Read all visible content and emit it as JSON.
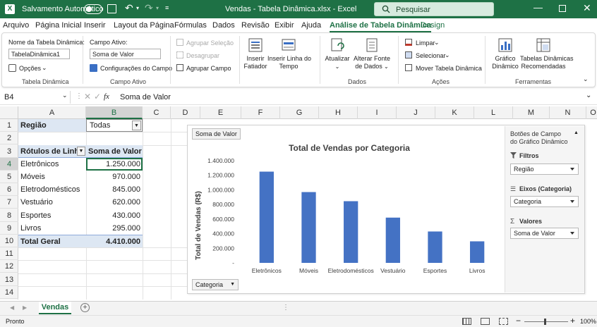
{
  "titlebar": {
    "autosave_label": "Salvamento Automático",
    "title": "Vendas - Tabela Dinâmica.xlsx  -  Excel",
    "search_placeholder": "Pesquisar"
  },
  "ribbon_tabs": [
    "Arquivo",
    "Página Inicial",
    "Inserir",
    "Layout da Página",
    "Fórmulas",
    "Dados",
    "Revisão",
    "Exibir",
    "Ajuda",
    "Análise de Tabela Dinâmica",
    "Design"
  ],
  "ribbon": {
    "pt_name_label": "Nome da Tabela Dinâmica:",
    "pt_name_value": "TabelaDinâmica1",
    "options": "Opções",
    "group_pt": "Tabela Dinâmica",
    "active_field_label": "Campo Ativo:",
    "active_field_value": "Soma de Valor",
    "field_settings": "Configurações do Campo",
    "group_active": "Campo Ativo",
    "group_selection": "Agrupar Seleção",
    "ungroup": "Desagrupar",
    "group_field": "Agrupar Campo",
    "insert_slicer_1": "Inserir",
    "insert_slicer_2": "Fatiador",
    "insert_timeline_1": "Inserir Linha do",
    "insert_timeline_2": "Tempo",
    "refresh": "Atualizar",
    "change_source_1": "Alterar Fonte",
    "change_source_2": "de Dados",
    "group_data": "Dados",
    "clear": "Limpar",
    "select": "Selecionar",
    "move": "Mover Tabela Dinâmica",
    "group_actions": "Ações",
    "pivot_chart_1": "Gráfico",
    "pivot_chart_2": "Dinâmico",
    "recommended_1": "Tabelas Dinâmicas",
    "recommended_2": "Recomendadas",
    "group_tools": "Ferramentas"
  },
  "formula_bar": {
    "name_box": "B4",
    "fx": "fx",
    "content": "Soma de Valor"
  },
  "columns": [
    "A",
    "B",
    "C",
    "D",
    "E",
    "F",
    "G",
    "H",
    "I",
    "J",
    "K",
    "L",
    "M",
    "N",
    "O"
  ],
  "rows": [
    "1",
    "2",
    "3",
    "4",
    "5",
    "6",
    "7",
    "8",
    "9",
    "10",
    "11",
    "12",
    "13",
    "14"
  ],
  "pivot": {
    "filter_label": "Região",
    "filter_value": "Todas",
    "row_header": "Rótulos de Linha",
    "value_header": "Soma de Valor",
    "items": [
      {
        "label": "Eletrônicos",
        "value": "1.250.000"
      },
      {
        "label": "Móveis",
        "value": "970.000"
      },
      {
        "label": "Eletrodomésticos",
        "value": "845.000"
      },
      {
        "label": "Vestuário",
        "value": "620.000"
      },
      {
        "label": "Esportes",
        "value": "430.000"
      },
      {
        "label": "Livros",
        "value": "295.000"
      }
    ],
    "total_label": "Total Geral",
    "total_value": "4.410.000"
  },
  "chart": {
    "value_button": "Soma de Valor",
    "axis_button": "Categoria"
  },
  "chart_data": {
    "type": "bar",
    "title": "Total de Vendas por Categoria",
    "ylabel": "Total de Vendas (R$)",
    "xlabel": "",
    "categories": [
      "Eletrônicos",
      "Móveis",
      "Eletrodomésticos",
      "Vestuário",
      "Esportes",
      "Livros"
    ],
    "values": [
      1250000,
      970000,
      845000,
      620000,
      430000,
      295000
    ],
    "ylim": [
      0,
      1400000
    ],
    "yticks": [
      "-",
      "200.000",
      "400.000",
      "600.000",
      "800.000",
      "1.000.000",
      "1.200.000",
      "1.400.000"
    ],
    "color": "#4472c4",
    "grid": false
  },
  "field_pane": {
    "title": "Botões de Campo do Gráfico Dinâmico",
    "filters_label": "Filtros",
    "filters_value": "Região",
    "axis_label": "Eixos (Categoria)",
    "axis_value": "Categoria",
    "values_label": "Valores",
    "values_value": "Soma de Valor"
  },
  "sheet_tab": "Vendas",
  "status": {
    "ready": "Pronto",
    "zoom": "100%"
  },
  "colors": {
    "excel_green": "#1e7145",
    "bar_blue": "#4472c4",
    "pivot_header": "#dde7f3"
  }
}
